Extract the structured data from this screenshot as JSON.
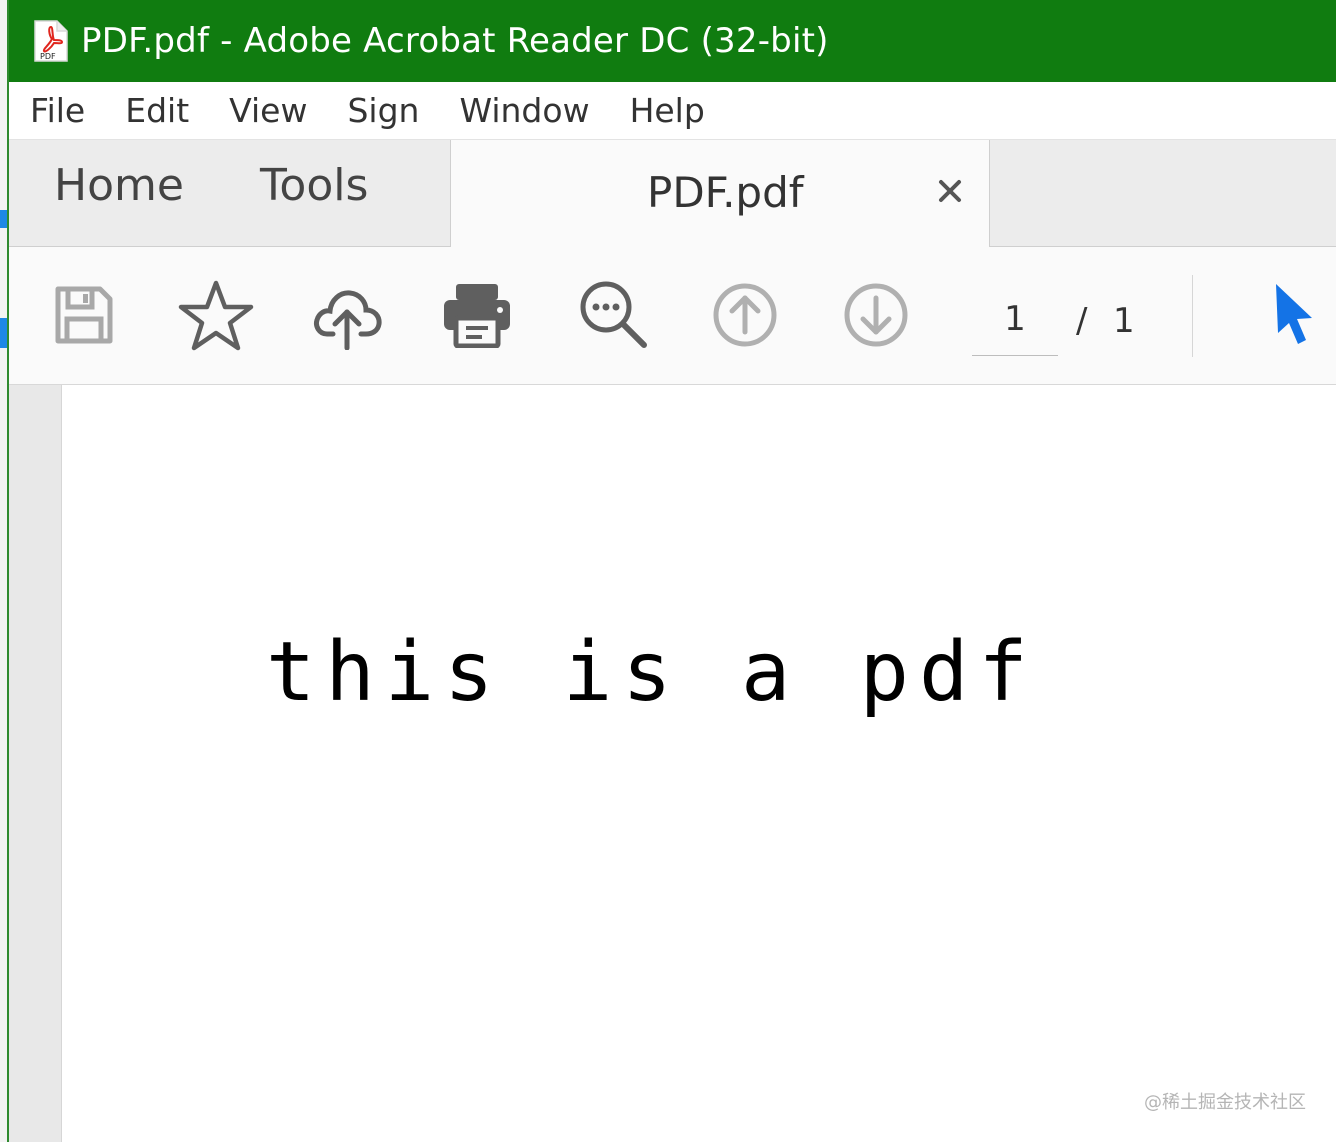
{
  "window": {
    "title": "PDF.pdf - Adobe Acrobat Reader DC (32-bit)",
    "app_icon": "acrobat-pdf-icon",
    "app_icon_text": "PDF",
    "title_bar_color": "#107c10"
  },
  "menubar": {
    "items": [
      "File",
      "Edit",
      "View",
      "Sign",
      "Window",
      "Help"
    ]
  },
  "tabs": {
    "home": "Home",
    "tools": "Tools",
    "document": "PDF.pdf",
    "close_icon": "close-icon"
  },
  "toolbar": {
    "icons": [
      "save-icon",
      "bookmark-star-icon",
      "upload-cloud-icon",
      "print-icon",
      "search-zoom-icon",
      "previous-page-icon",
      "next-page-icon",
      "select-cursor-icon"
    ],
    "current_page": "1",
    "separator": "/",
    "total_pages": "1",
    "accent_color": "#1473e6"
  },
  "document": {
    "text": "this is a pdf"
  },
  "watermark": "@稀土掘金技术社区"
}
